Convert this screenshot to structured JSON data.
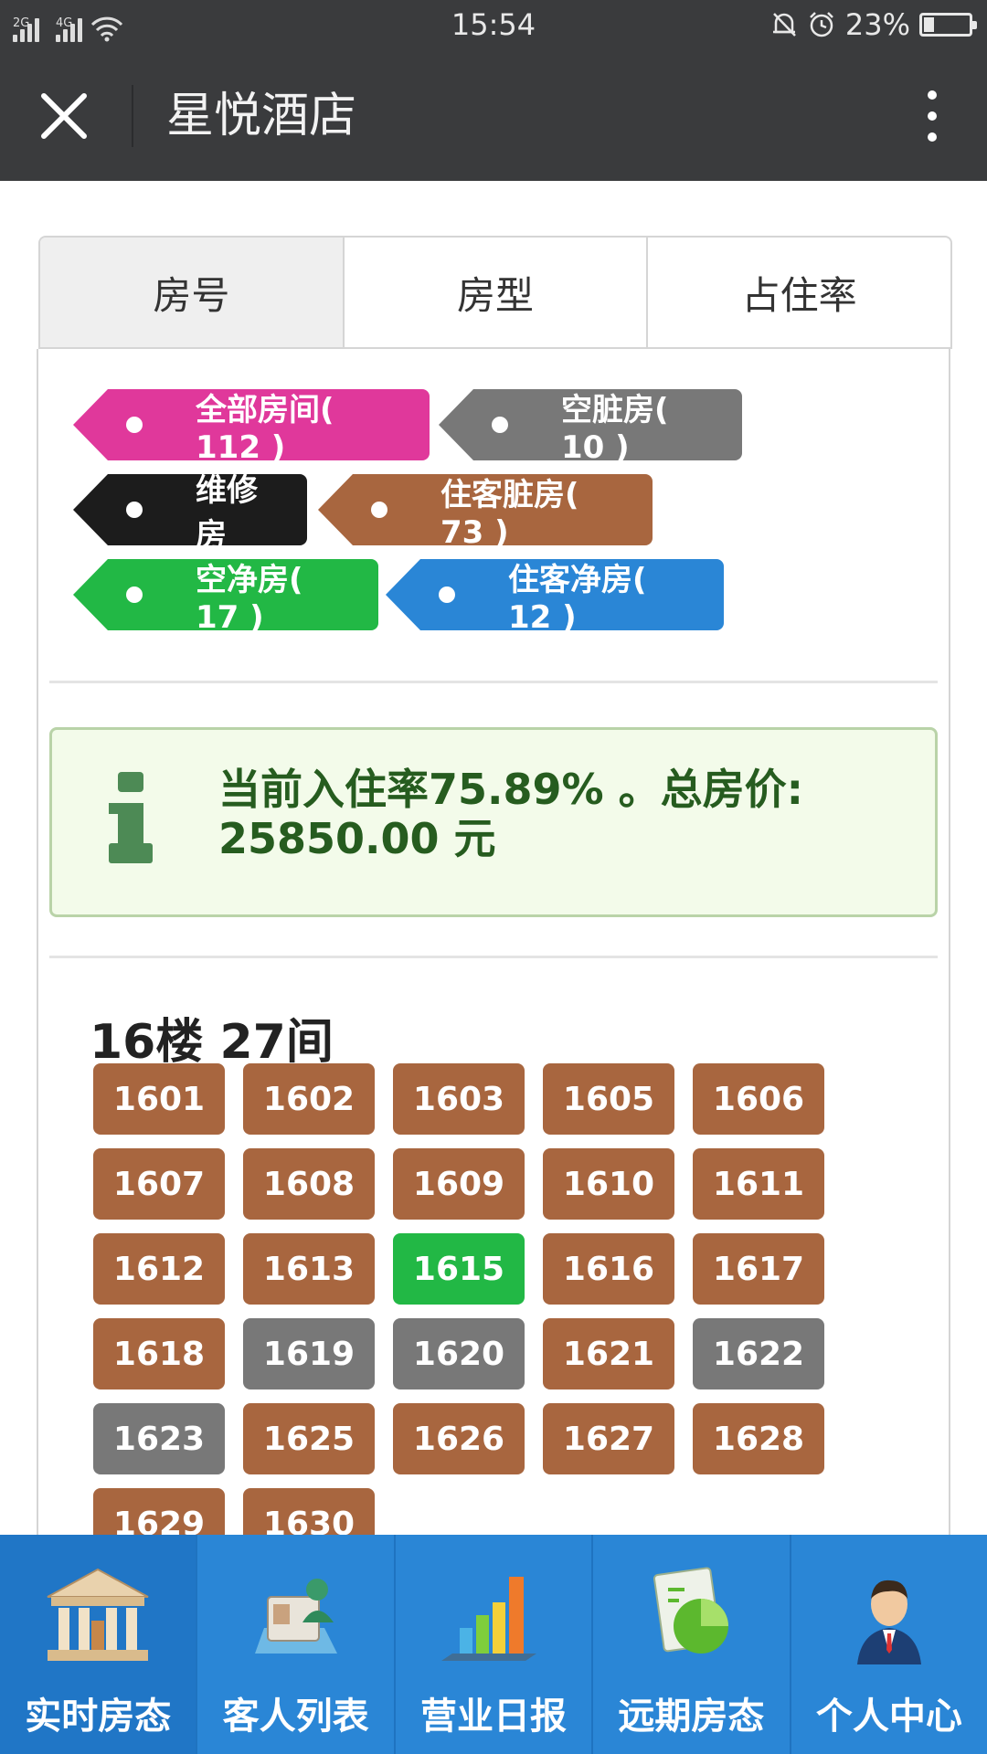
{
  "statusbar": {
    "net1": "2G",
    "net2": "4G",
    "time": "15:54",
    "battery": "23%",
    "battery_level": 0.23
  },
  "titlebar": {
    "title": "星悦酒店"
  },
  "tabs": [
    "房号",
    "房型",
    "占住率"
  ],
  "legend": [
    {
      "label": "全部房间( 112 )",
      "color": "#e0389b"
    },
    {
      "label": "空脏房( 10 )",
      "color": "#787878"
    },
    {
      "label": "维修房",
      "color": "#1c1c1c"
    },
    {
      "label": "住客脏房( 73 )",
      "color": "#a8663f"
    },
    {
      "label": "空净房( 17 )",
      "color": "#22b845"
    },
    {
      "label": "住客净房( 12 )",
      "color": "#2a86d6"
    }
  ],
  "info": {
    "text": "当前入住率75.89% 。总房价: 25850.00 元"
  },
  "floor": {
    "title": "16楼 27间",
    "rooms": [
      {
        "no": "1601",
        "status": "occupied-dirty"
      },
      {
        "no": "1602",
        "status": "occupied-dirty"
      },
      {
        "no": "1603",
        "status": "occupied-dirty"
      },
      {
        "no": "1605",
        "status": "occupied-dirty"
      },
      {
        "no": "1606",
        "status": "occupied-dirty"
      },
      {
        "no": "1607",
        "status": "occupied-dirty"
      },
      {
        "no": "1608",
        "status": "occupied-dirty"
      },
      {
        "no": "1609",
        "status": "occupied-dirty"
      },
      {
        "no": "1610",
        "status": "occupied-dirty"
      },
      {
        "no": "1611",
        "status": "occupied-dirty"
      },
      {
        "no": "1612",
        "status": "occupied-dirty"
      },
      {
        "no": "1613",
        "status": "occupied-dirty"
      },
      {
        "no": "1615",
        "status": "vacant-clean"
      },
      {
        "no": "1616",
        "status": "occupied-dirty"
      },
      {
        "no": "1617",
        "status": "occupied-dirty"
      },
      {
        "no": "1618",
        "status": "occupied-dirty"
      },
      {
        "no": "1619",
        "status": "vacant-dirty"
      },
      {
        "no": "1620",
        "status": "vacant-dirty"
      },
      {
        "no": "1621",
        "status": "occupied-dirty"
      },
      {
        "no": "1622",
        "status": "vacant-dirty"
      },
      {
        "no": "1623",
        "status": "vacant-dirty"
      },
      {
        "no": "1625",
        "status": "occupied-dirty"
      },
      {
        "no": "1626",
        "status": "occupied-dirty"
      },
      {
        "no": "1627",
        "status": "occupied-dirty"
      },
      {
        "no": "1628",
        "status": "occupied-dirty"
      },
      {
        "no": "1629",
        "status": "occupied-dirty"
      },
      {
        "no": "1630",
        "status": "occupied-dirty"
      }
    ]
  },
  "status_colors": {
    "occupied-dirty": "#a8663f",
    "vacant-clean": "#22b845",
    "vacant-dirty": "#787878"
  },
  "bottomnav": [
    {
      "label": "实时房态",
      "icon": "bank-icon"
    },
    {
      "label": "客人列表",
      "icon": "guest-card-icon"
    },
    {
      "label": "营业日报",
      "icon": "bar-chart-icon"
    },
    {
      "label": "远期房态",
      "icon": "pie-chart-icon"
    },
    {
      "label": "个人中心",
      "icon": "user-icon"
    }
  ]
}
